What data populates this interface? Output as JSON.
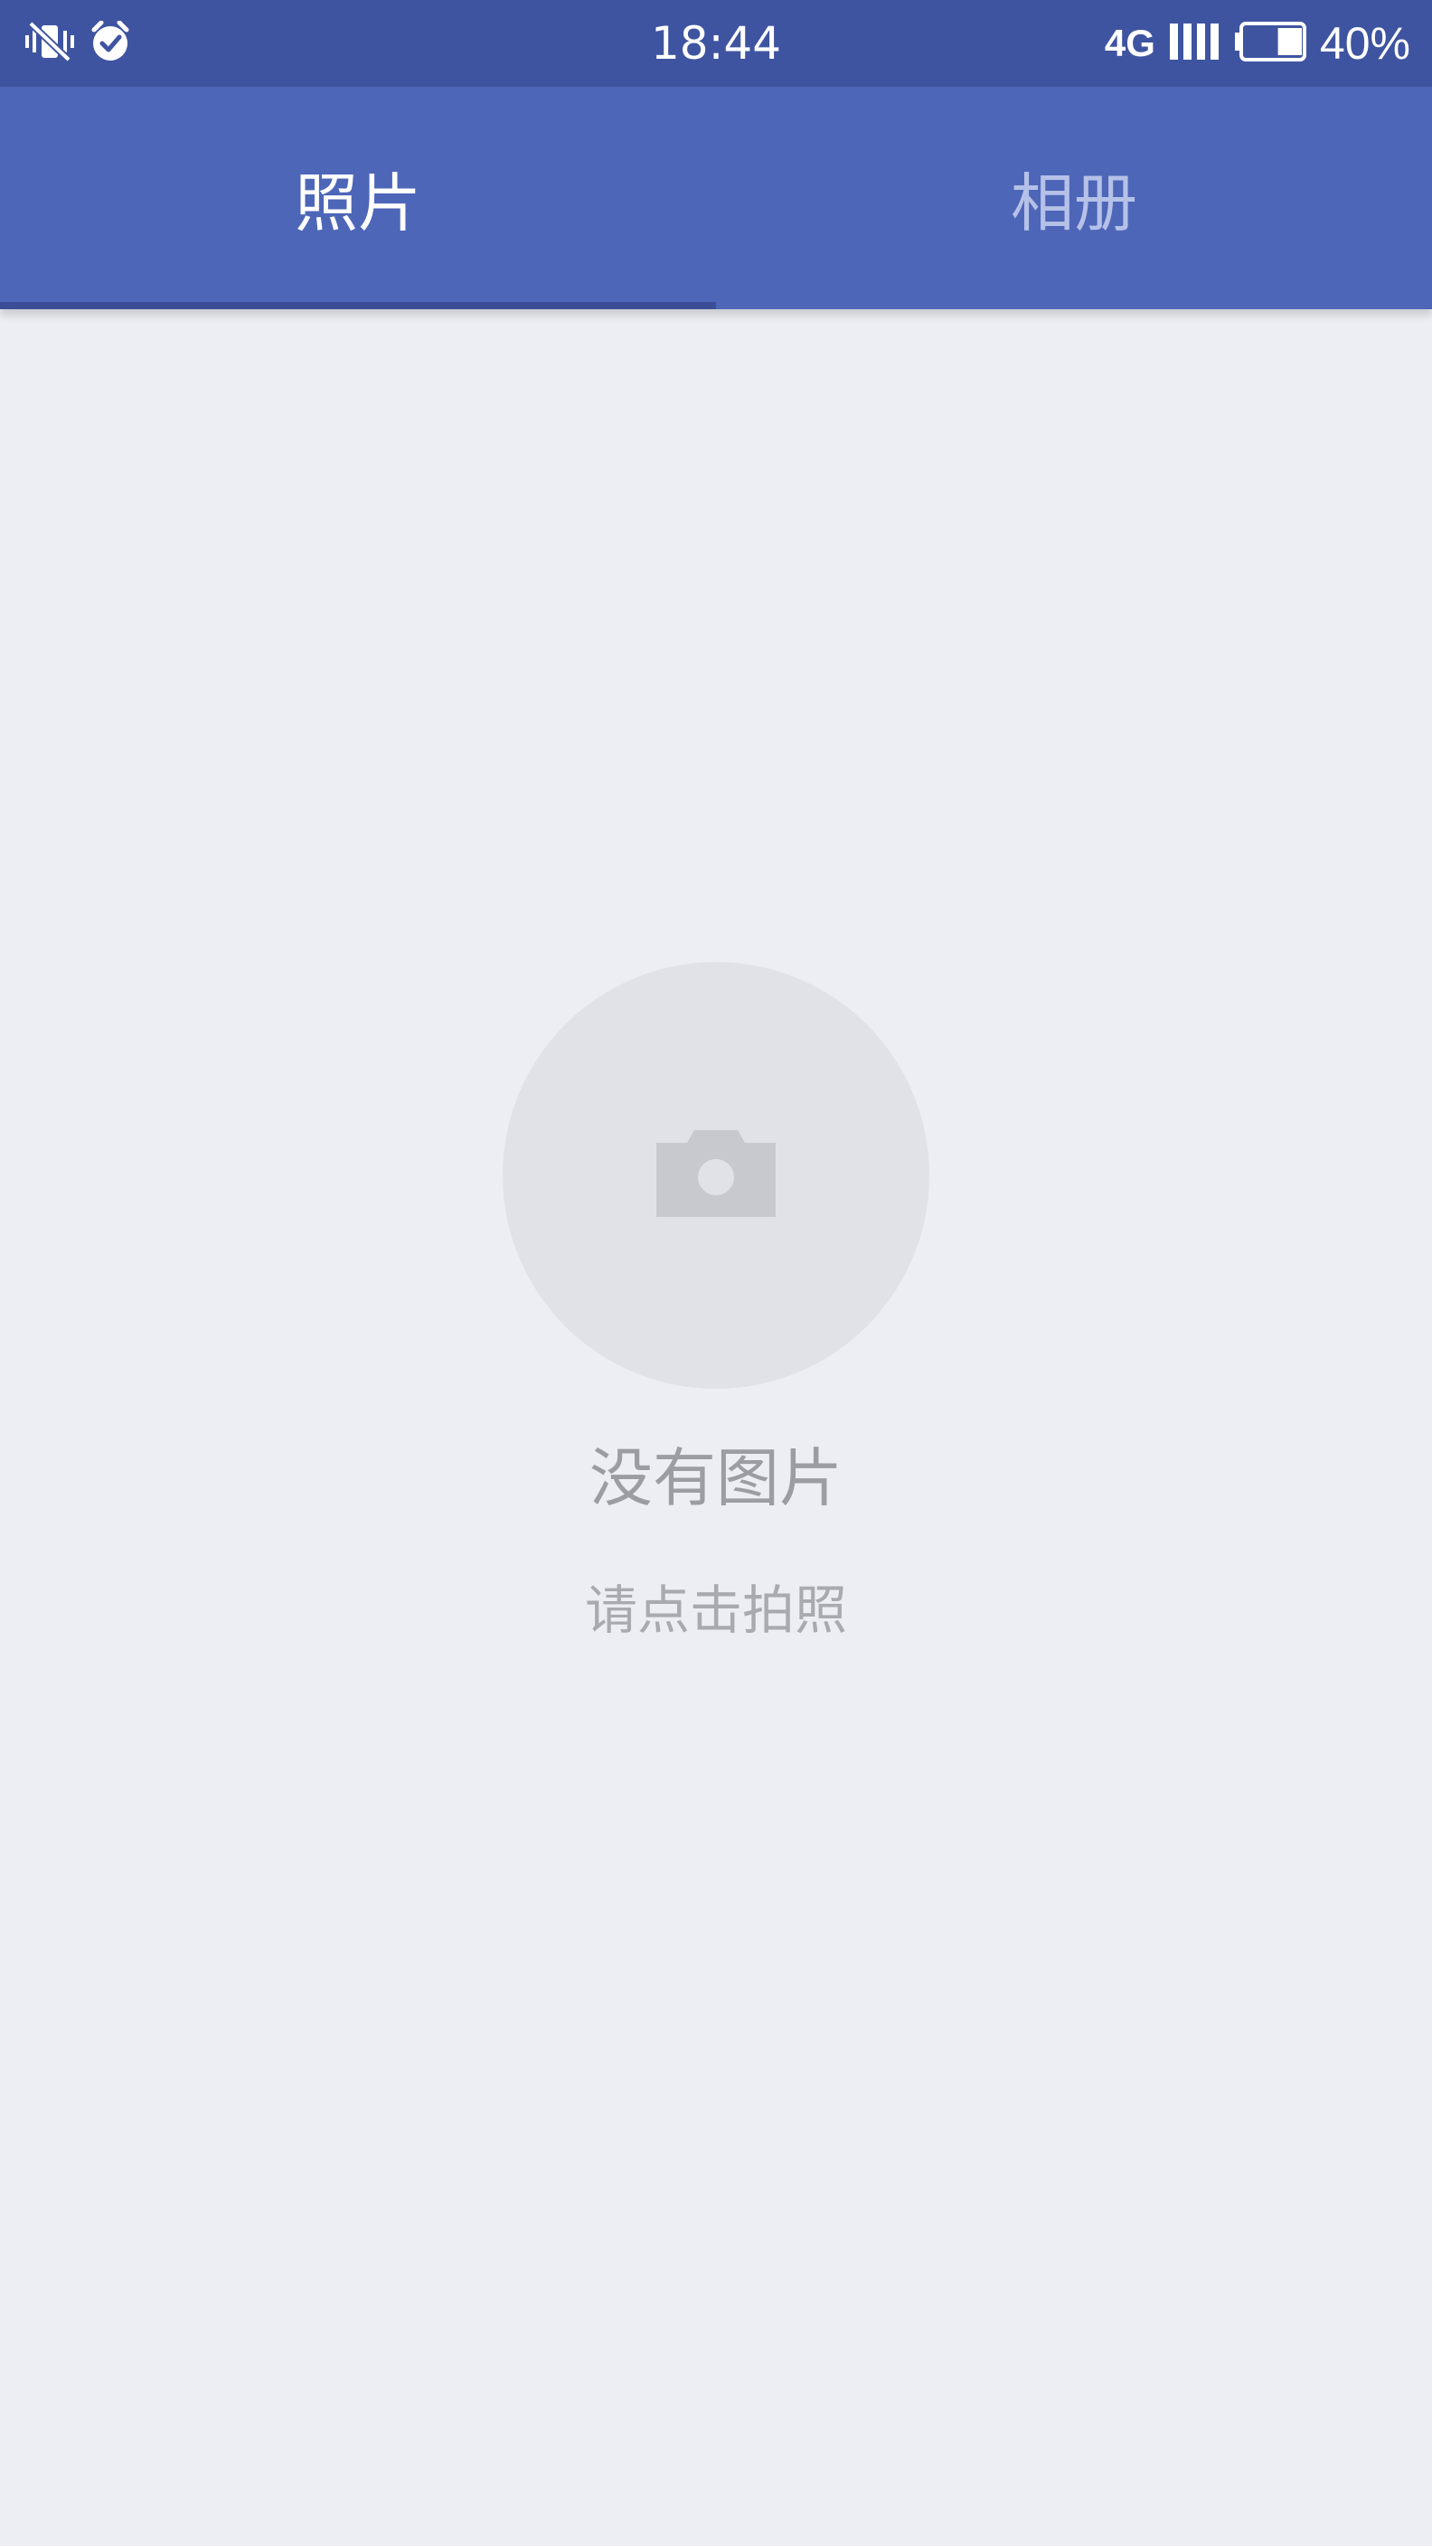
{
  "status_bar": {
    "time": "18:44",
    "network": "4G",
    "battery": "40%",
    "battery_level": 0.4,
    "icons": [
      "vibrate-icon",
      "alarm-icon",
      "signal-icon",
      "battery-icon"
    ]
  },
  "tabs": [
    {
      "label": "照片",
      "active": true
    },
    {
      "label": "相册",
      "active": false
    }
  ],
  "empty_state": {
    "icon": "camera-icon",
    "title": "没有图片",
    "hint": "请点击拍照"
  },
  "colors": {
    "status_bar": "#3f54a0",
    "tab_bar": "#4d66b8",
    "tab_active_text": "#ffffff",
    "tab_inactive_text": "#b6c1e8",
    "tab_indicator": "#3a4d96",
    "background": "#edeef3",
    "empty_circle": "#e1e2e7",
    "camera_icon": "#c8c9ce"
  }
}
